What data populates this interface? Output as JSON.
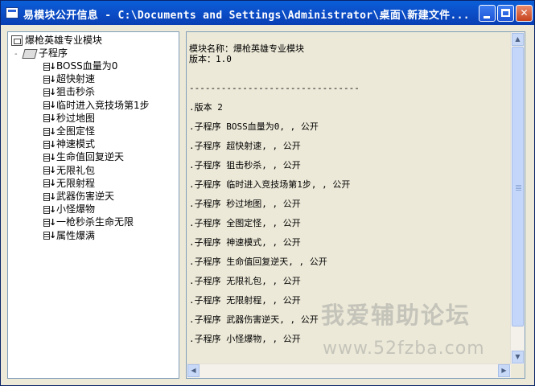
{
  "window": {
    "title": "易模块公开信息 - C:\\Documents and Settings\\Administrator\\桌面\\新建文件..."
  },
  "titlebar_buttons": [
    "minimize",
    "maximize",
    "close"
  ],
  "tree": {
    "root": "爆枪英雄专业模块",
    "group": "子程序",
    "group_expand": "-",
    "items": [
      "BOSS血量为0",
      "超快射速",
      "狙击秒杀",
      "临时进入竞技场第1步",
      "秒过地图",
      "全图定怪",
      "神速模式",
      "生命值回复逆天",
      "无限礼包",
      "无限射程",
      "武器伤害逆天",
      "小怪爆物",
      "一枪秒杀生命无限",
      "属性爆满"
    ]
  },
  "editor": {
    "lines": [
      "模块名称：爆枪英雄专业模块",
      "版本：1.0",
      "--------------------------------",
      ".版本 2",
      ".子程序 BOSS血量为0, , 公开",
      ".子程序 超快射速, , 公开",
      ".子程序 狙击秒杀, , 公开",
      ".子程序 临时进入竞技场第1步, , 公开",
      ".子程序 秒过地图, , 公开",
      ".子程序 全图定怪, , 公开",
      ".子程序 神速模式, , 公开",
      ".子程序 生命值回复逆天, , 公开",
      ".子程序 无限礼包, , 公开",
      ".子程序 无限射程, , 公开",
      ".子程序 武器伤害逆天, , 公开",
      ".子程序 小怪爆物, , 公开"
    ]
  },
  "watermark": {
    "text": "我爱辅助论坛",
    "url": "www.52fzba.com"
  }
}
